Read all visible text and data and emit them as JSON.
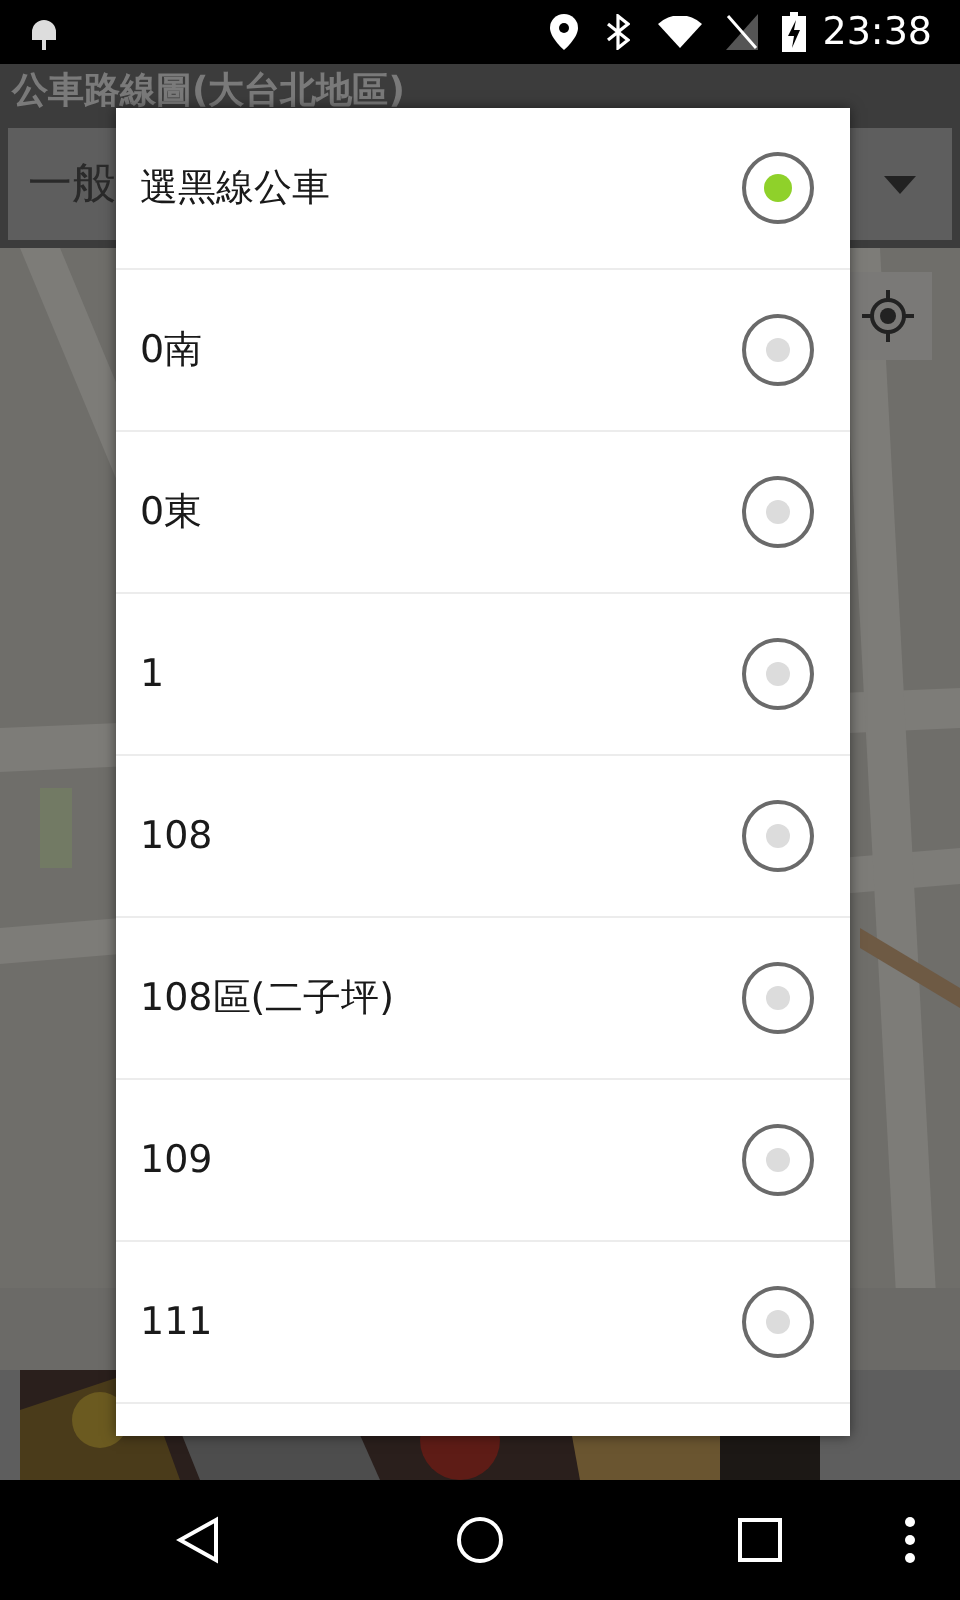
{
  "status_bar": {
    "time": "23:38"
  },
  "app_bar": {
    "title": "公車路線圖(大台北地區)"
  },
  "spinner": {
    "value": "一般"
  },
  "dialog": {
    "options": [
      {
        "label": "選黑線公車",
        "selected": true
      },
      {
        "label": "0南",
        "selected": false
      },
      {
        "label": "0東",
        "selected": false
      },
      {
        "label": "1",
        "selected": false
      },
      {
        "label": "108",
        "selected": false
      },
      {
        "label": "108區(二子坪)",
        "selected": false
      },
      {
        "label": "109",
        "selected": false
      },
      {
        "label": "111",
        "selected": false
      }
    ]
  }
}
